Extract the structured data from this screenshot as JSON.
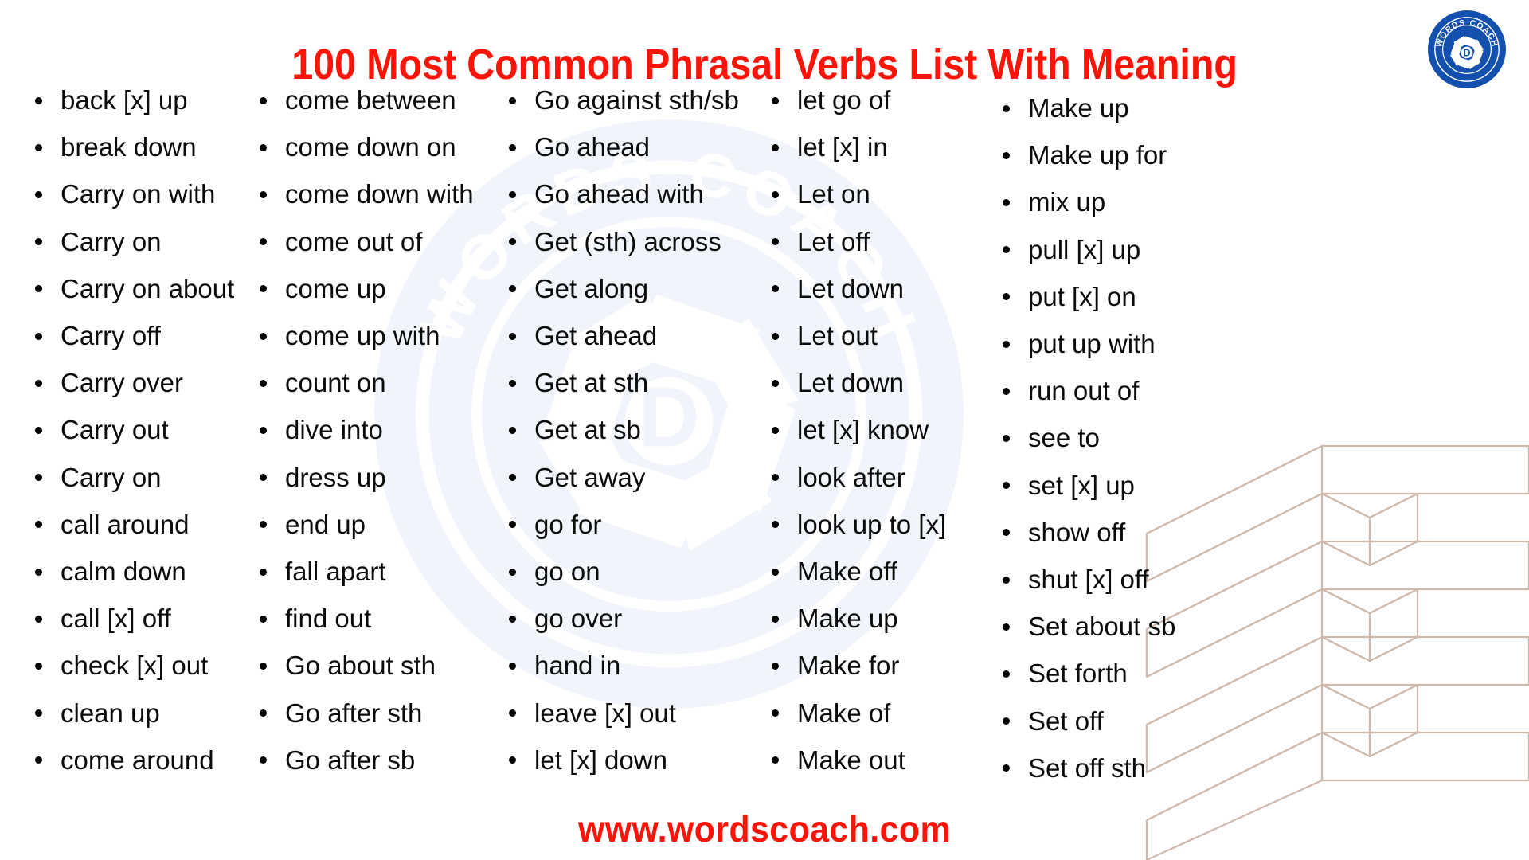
{
  "header": {
    "title": "100 Most Common Phrasal Verbs List With Meaning",
    "title_color": "#fc1408"
  },
  "logo": {
    "name": "words-coach-logo",
    "ring_text": "WORDS COACH",
    "center_letter": "D",
    "color": "#1450ad"
  },
  "watermark": {
    "ring_text": "WORDS COACH",
    "center_letter": "D",
    "color": "#f1f5fb"
  },
  "decoration": {
    "name": "isometric-blocks",
    "line_color": "#cfb8ac"
  },
  "footer": {
    "url": "www.wordscoach.com",
    "color": "#fc1408"
  },
  "columns": [
    {
      "id": "col-1",
      "items": [
        "back [x] up",
        "break down",
        "Carry on with",
        "Carry on",
        "Carry on about",
        "Carry off",
        "Carry over",
        "Carry out",
        "Carry on",
        "call around",
        "calm down",
        "call [x] off",
        "check [x] out",
        "clean up",
        "come around"
      ]
    },
    {
      "id": "col-2",
      "items": [
        "come between",
        "come down on",
        "come down with",
        "come out of",
        "come up",
        "come up with",
        "count on",
        "dive into",
        "dress up",
        "end up",
        "fall apart",
        "find out",
        "Go about sth",
        "Go after sth",
        "Go after sb"
      ]
    },
    {
      "id": "col-3",
      "items": [
        "Go against sth/sb",
        "Go ahead",
        "Go ahead with",
        "Get (sth) across",
        "Get along",
        "Get ahead",
        "Get at sth",
        "Get at sb",
        "Get away",
        "go for",
        "go on",
        "go over",
        "hand in",
        "leave [x] out",
        "let [x] down"
      ]
    },
    {
      "id": "col-4",
      "items": [
        "let go of",
        "let [x] in",
        "Let on",
        "Let off",
        "Let down",
        "Let out",
        "Let down",
        "let [x] know",
        "look after",
        "look up to [x]",
        "Make off",
        "Make up",
        "Make for",
        "Make of",
        "Make out"
      ]
    },
    {
      "id": "col-5",
      "items": [
        "Make up",
        "Make up for",
        "mix up",
        "pull [x] up",
        "put [x] on",
        "put up with",
        "run out of",
        "see to",
        "set [x] up",
        "show off",
        "shut [x] off",
        "Set about sb",
        "Set forth",
        "Set off",
        "Set off sth"
      ]
    }
  ]
}
